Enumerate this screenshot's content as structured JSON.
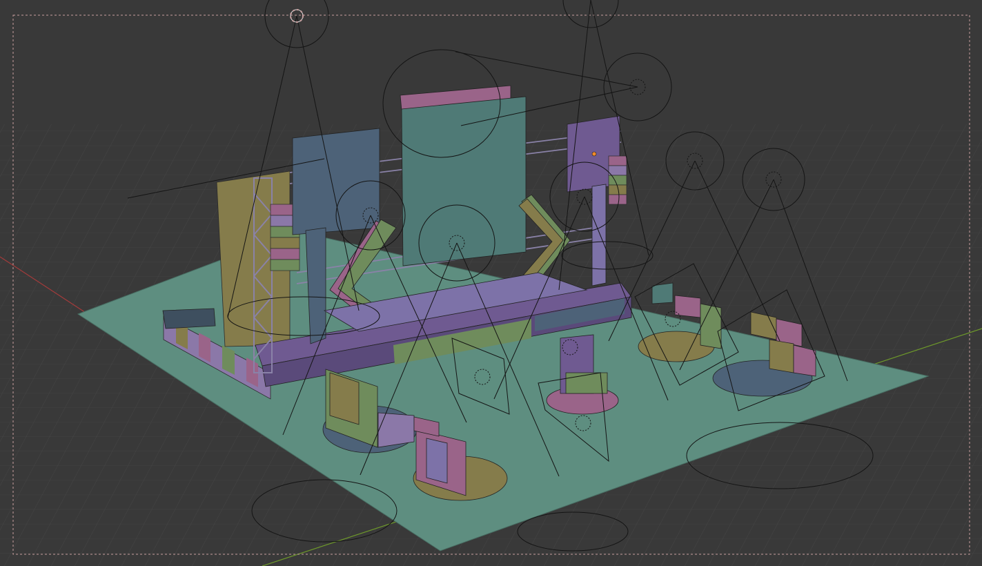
{
  "viewport": {
    "background": "#393939",
    "grid_color": "#4a4a4a",
    "axis_x_color": "#a23b3b",
    "axis_y_color": "#6e9a2a",
    "camera_frame_color": "#c9a0a0",
    "selected_origin_color": "#f08a2a",
    "light_wire_color": "#141414"
  },
  "palette": {
    "floor": "#5e8e80",
    "teal": "#4f7a76",
    "slate": "#4d6278",
    "purple": "#6f5a91",
    "pink": "#9a6489",
    "olive": "#857c4b",
    "green": "#6f8c5c",
    "lavender": "#7d72a8",
    "truss": "#8a82a8"
  }
}
